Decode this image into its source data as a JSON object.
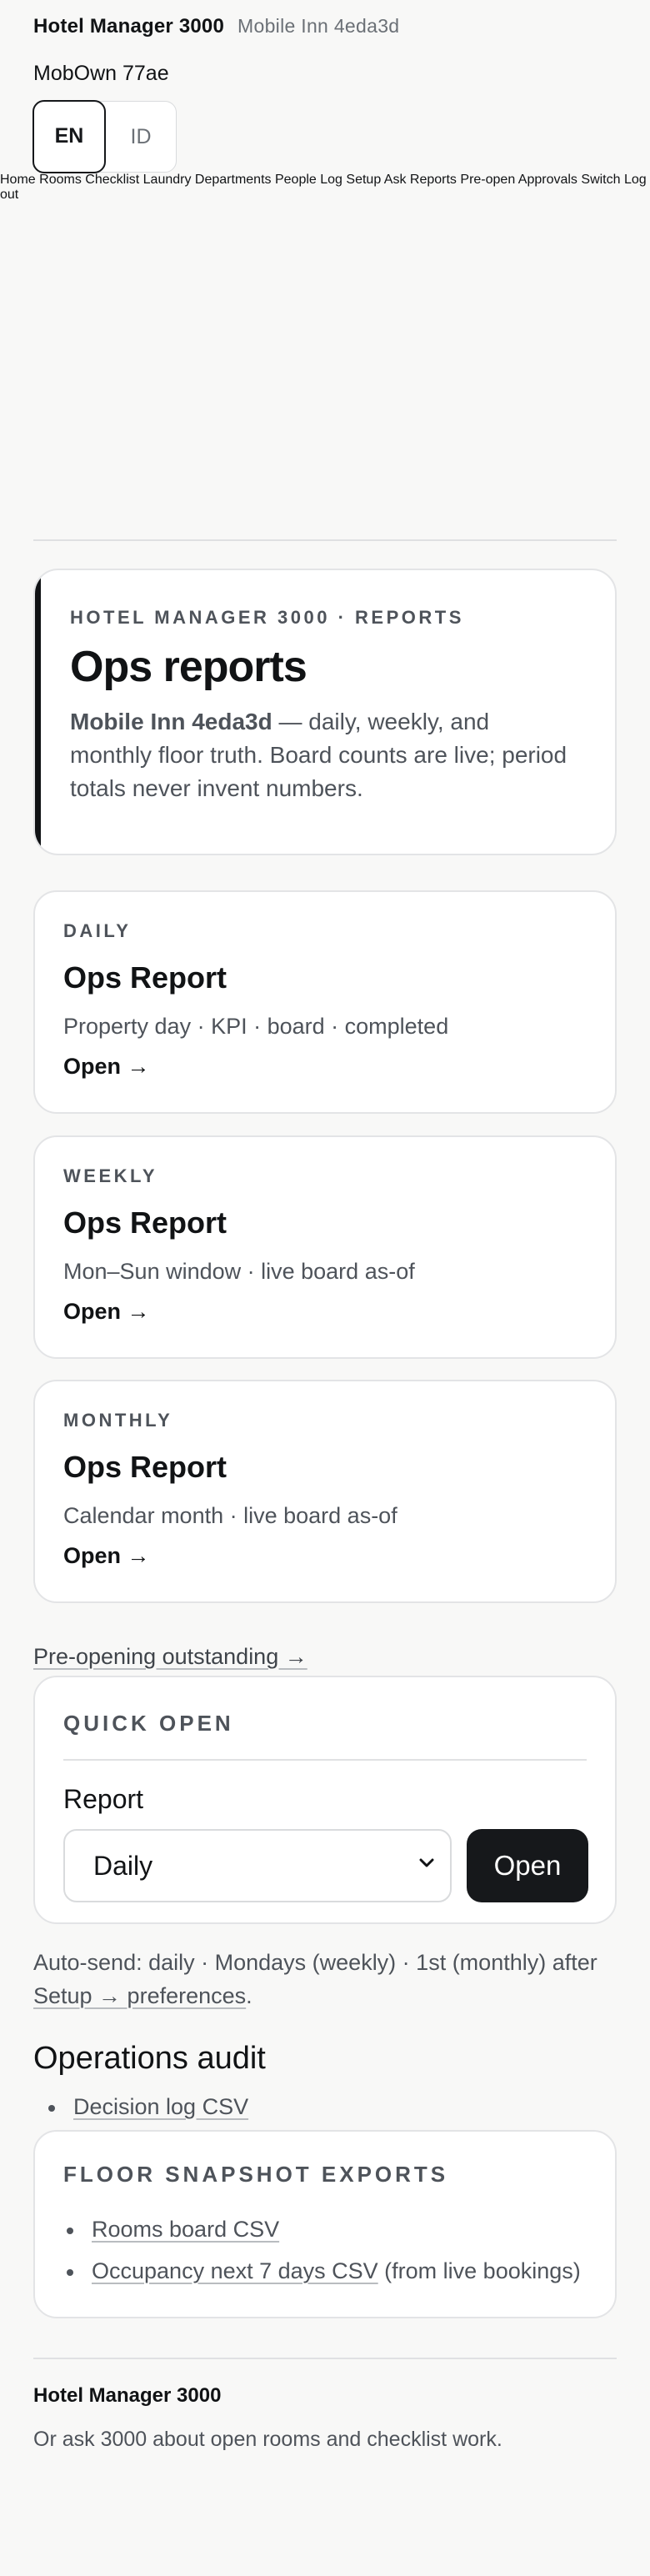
{
  "header": {
    "brand": "Hotel Manager 3000",
    "property": "Mobile Inn 4eda3d",
    "user": "MobOwn 77ae",
    "languages": [
      "EN",
      "ID"
    ],
    "active_language": "EN"
  },
  "nav": {
    "items": [
      "Home",
      "Rooms",
      "Checklist",
      "Laundry",
      "Departments",
      "People",
      "Log",
      "Setup",
      "Ask",
      "Reports",
      "Pre-open",
      "Approvals"
    ],
    "switch": "Switch",
    "logout": "Log out"
  },
  "hero": {
    "eyebrow": "HOTEL MANAGER 3000 · REPORTS",
    "title": "Ops reports",
    "property": "Mobile Inn 4eda3d",
    "lead": " — daily, weekly, and monthly floor truth. Board counts are live; period totals never invent numbers."
  },
  "cards": [
    {
      "kicker": "DAILY",
      "title": "Ops Report",
      "desc": "Property day · KPI · board · completed",
      "open": "Open →"
    },
    {
      "kicker": "WEEKLY",
      "title": "Ops Report",
      "desc": "Mon–Sun window · live board as-of",
      "open": "Open →"
    },
    {
      "kicker": "MONTHLY",
      "title": "Ops Report",
      "desc": "Calendar month · live board as-of",
      "open": "Open →"
    }
  ],
  "preopen_link": "Pre-opening outstanding →",
  "quick_open": {
    "title": "QUICK OPEN",
    "label": "Report",
    "selected": "Daily",
    "button": "Open"
  },
  "autosend": {
    "text": "Auto-send: daily · Mondays (weekly) · 1st (monthly) after ",
    "link": "Setup → preferences",
    "end": "."
  },
  "audit": {
    "title": "Operations audit",
    "items": [
      "Decision log CSV"
    ]
  },
  "snapshot": {
    "title": "FLOOR SNAPSHOT EXPORTS",
    "rooms": "Rooms board CSV",
    "occupancy": "Occupancy next 7 days CSV",
    "occupancy_note": " (from live bookings)"
  },
  "footer": {
    "brand": "Hotel Manager 3000",
    "text": "Or ask 3000 about open rooms and checklist work."
  }
}
